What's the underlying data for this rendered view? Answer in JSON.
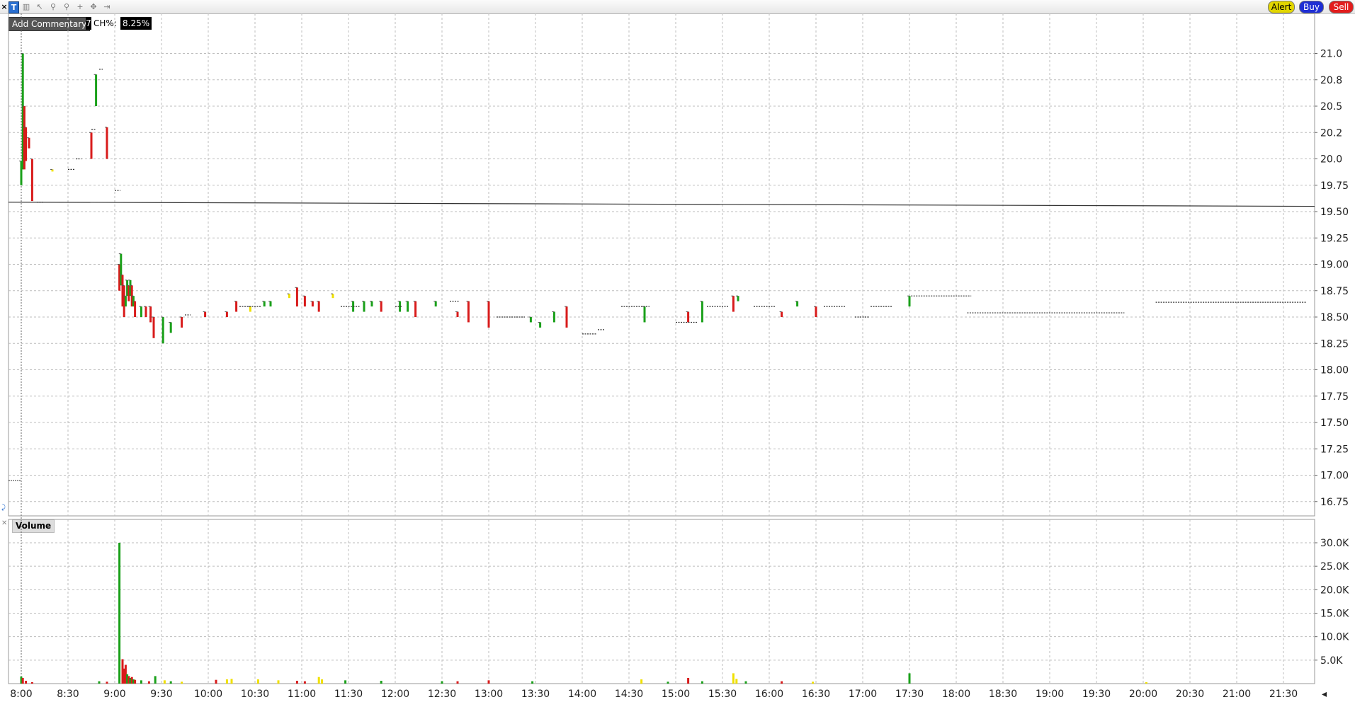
{
  "toolbar": {
    "close_glyph": "×",
    "chart_type_label": "T",
    "tools": [
      {
        "name": "bar-chart-icon",
        "glyph": "▥"
      },
      {
        "name": "cursor-icon",
        "glyph": "↖"
      },
      {
        "name": "zoom-in-icon",
        "glyph": "⚲"
      },
      {
        "name": "zoom-out-icon",
        "glyph": "⚲"
      },
      {
        "name": "crosshair-icon",
        "glyph": "+"
      },
      {
        "name": "move-icon",
        "glyph": "✥"
      },
      {
        "name": "pan-icon",
        "glyph": "⇥"
      }
    ],
    "alert_label": "Alert",
    "buy_label": "Buy",
    "sell_label": "Sell"
  },
  "overlay": {
    "add_commentary": "Add Commentary",
    "marker": "7",
    "ch_label": "CH%:",
    "ch_value": "8.25%"
  },
  "volume_pane": {
    "label": "Volume"
  },
  "colors": {
    "up": "#1aa01a",
    "down": "#d81b1b",
    "flat": "#f0e000",
    "grid": "#bdbdbd",
    "alert_bg": "#e2d600",
    "buy_bg": "#1f2fd4",
    "sell_bg": "#e21d1d"
  },
  "chart_data": {
    "type": "bar",
    "price_axis": {
      "ticks": [
        "21.0",
        "20.8",
        "20.5",
        "20.2",
        "20.0",
        "19.75",
        "19.50",
        "19.25",
        "19.00",
        "18.75",
        "18.50",
        "18.25",
        "18.00",
        "17.75",
        "17.50",
        "17.25",
        "17.00",
        "16.75"
      ],
      "tick_values": [
        21.0,
        20.75,
        20.5,
        20.25,
        20.0,
        19.75,
        19.5,
        19.25,
        19.0,
        18.75,
        18.5,
        18.25,
        18.0,
        17.75,
        17.5,
        17.25,
        17.0,
        16.75
      ]
    },
    "volume_axis": {
      "ticks": [
        "30.0K",
        "25.0K",
        "20.0K",
        "15.0K",
        "10.0K",
        "5.0K"
      ],
      "tick_values": [
        30000,
        25000,
        20000,
        15000,
        10000,
        5000
      ]
    },
    "time_axis": {
      "ticks": [
        "8:00",
        "8:30",
        "9:00",
        "9:30",
        "10:00",
        "10:30",
        "11:00",
        "11:30",
        "12:00",
        "12:30",
        "13:00",
        "13:30",
        "14:00",
        "14:30",
        "15:00",
        "15:30",
        "16:00",
        "16:30",
        "17:00",
        "17:30",
        "18:00",
        "18:30",
        "19:00",
        "19:30",
        "20:00",
        "20:30",
        "21:00",
        "21:30"
      ]
    },
    "reference_line": {
      "start": 19.59,
      "end": 19.55
    },
    "bars": [
      {
        "t": "8:00",
        "h": 19.98,
        "l": 19.75,
        "c": "up"
      },
      {
        "t": "8:01",
        "h": 21.0,
        "l": 19.9,
        "c": "up"
      },
      {
        "t": "8:02",
        "h": 20.5,
        "l": 19.9,
        "c": "down"
      },
      {
        "t": "8:03",
        "h": 20.3,
        "l": 19.98,
        "c": "down"
      },
      {
        "t": "8:05",
        "h": 20.2,
        "l": 20.1,
        "c": "down"
      },
      {
        "t": "8:07",
        "h": 20.0,
        "l": 19.6,
        "c": "down"
      },
      {
        "t": "8:20",
        "h": 19.9,
        "l": 19.88,
        "c": "flat"
      },
      {
        "t": "8:45",
        "h": 20.25,
        "l": 20.0,
        "c": "down"
      },
      {
        "t": "8:48",
        "h": 20.8,
        "l": 20.5,
        "c": "up"
      },
      {
        "t": "8:55",
        "h": 20.3,
        "l": 20.0,
        "c": "down"
      },
      {
        "t": "9:03",
        "h": 19.0,
        "l": 18.75,
        "c": "down"
      },
      {
        "t": "9:04",
        "h": 19.1,
        "l": 18.8,
        "c": "up"
      },
      {
        "t": "9:05",
        "h": 18.9,
        "l": 18.6,
        "c": "down"
      },
      {
        "t": "9:06",
        "h": 18.8,
        "l": 18.5,
        "c": "down"
      },
      {
        "t": "9:07",
        "h": 18.7,
        "l": 18.6,
        "c": "up"
      },
      {
        "t": "9:08",
        "h": 18.85,
        "l": 18.7,
        "c": "up"
      },
      {
        "t": "9:09",
        "h": 18.8,
        "l": 18.65,
        "c": "down"
      },
      {
        "t": "9:10",
        "h": 18.85,
        "l": 18.7,
        "c": "up"
      },
      {
        "t": "9:11",
        "h": 18.8,
        "l": 18.6,
        "c": "down"
      },
      {
        "t": "9:12",
        "h": 18.7,
        "l": 18.6,
        "c": "up"
      },
      {
        "t": "9:13",
        "h": 18.65,
        "l": 18.5,
        "c": "down"
      },
      {
        "t": "9:17",
        "h": 18.6,
        "l": 18.5,
        "c": "up"
      },
      {
        "t": "9:20",
        "h": 18.6,
        "l": 18.5,
        "c": "down"
      },
      {
        "t": "9:23",
        "h": 18.6,
        "l": 18.45,
        "c": "down"
      },
      {
        "t": "9:25",
        "h": 18.5,
        "l": 18.3,
        "c": "down"
      },
      {
        "t": "9:31",
        "h": 18.5,
        "l": 18.25,
        "c": "up"
      },
      {
        "t": "9:36",
        "h": 18.45,
        "l": 18.35,
        "c": "up"
      },
      {
        "t": "9:43",
        "h": 18.5,
        "l": 18.4,
        "c": "down"
      },
      {
        "t": "9:58",
        "h": 18.55,
        "l": 18.5,
        "c": "down"
      },
      {
        "t": "10:12",
        "h": 18.55,
        "l": 18.5,
        "c": "down"
      },
      {
        "t": "10:18",
        "h": 18.65,
        "l": 18.55,
        "c": "down"
      },
      {
        "t": "10:27",
        "h": 18.6,
        "l": 18.55,
        "c": "flat"
      },
      {
        "t": "10:36",
        "h": 18.65,
        "l": 18.6,
        "c": "up"
      },
      {
        "t": "10:40",
        "h": 18.65,
        "l": 18.6,
        "c": "up"
      },
      {
        "t": "10:52",
        "h": 18.72,
        "l": 18.68,
        "c": "flat"
      },
      {
        "t": "10:57",
        "h": 18.78,
        "l": 18.6,
        "c": "down"
      },
      {
        "t": "11:02",
        "h": 18.7,
        "l": 18.6,
        "c": "down"
      },
      {
        "t": "11:07",
        "h": 18.65,
        "l": 18.6,
        "c": "down"
      },
      {
        "t": "11:11",
        "h": 18.65,
        "l": 18.55,
        "c": "down"
      },
      {
        "t": "11:20",
        "h": 18.72,
        "l": 18.68,
        "c": "flat"
      },
      {
        "t": "11:33",
        "h": 18.65,
        "l": 18.55,
        "c": "up"
      },
      {
        "t": "11:40",
        "h": 18.65,
        "l": 18.55,
        "c": "up"
      },
      {
        "t": "11:45",
        "h": 18.65,
        "l": 18.6,
        "c": "up"
      },
      {
        "t": "11:51",
        "h": 18.65,
        "l": 18.55,
        "c": "down"
      },
      {
        "t": "12:03",
        "h": 18.65,
        "l": 18.55,
        "c": "up"
      },
      {
        "t": "12:08",
        "h": 18.65,
        "l": 18.55,
        "c": "up"
      },
      {
        "t": "12:13",
        "h": 18.65,
        "l": 18.5,
        "c": "down"
      },
      {
        "t": "12:26",
        "h": 18.65,
        "l": 18.6,
        "c": "up"
      },
      {
        "t": "12:40",
        "h": 18.55,
        "l": 18.5,
        "c": "down"
      },
      {
        "t": "12:47",
        "h": 18.65,
        "l": 18.45,
        "c": "down"
      },
      {
        "t": "13:00",
        "h": 18.65,
        "l": 18.4,
        "c": "down"
      },
      {
        "t": "13:27",
        "h": 18.5,
        "l": 18.45,
        "c": "up"
      },
      {
        "t": "13:33",
        "h": 18.45,
        "l": 18.4,
        "c": "up"
      },
      {
        "t": "13:42",
        "h": 18.55,
        "l": 18.45,
        "c": "up"
      },
      {
        "t": "13:50",
        "h": 18.6,
        "l": 18.4,
        "c": "down"
      },
      {
        "t": "14:40",
        "h": 18.6,
        "l": 18.45,
        "c": "up"
      },
      {
        "t": "15:08",
        "h": 18.55,
        "l": 18.45,
        "c": "down"
      },
      {
        "t": "15:17",
        "h": 18.65,
        "l": 18.45,
        "c": "up"
      },
      {
        "t": "15:37",
        "h": 18.7,
        "l": 18.55,
        "c": "down"
      },
      {
        "t": "15:40",
        "h": 18.7,
        "l": 18.65,
        "c": "up"
      },
      {
        "t": "16:08",
        "h": 18.55,
        "l": 18.5,
        "c": "down"
      },
      {
        "t": "16:18",
        "h": 18.65,
        "l": 18.6,
        "c": "up"
      },
      {
        "t": "16:30",
        "h": 18.6,
        "l": 18.5,
        "c": "down"
      },
      {
        "t": "17:30",
        "h": 18.7,
        "l": 18.6,
        "c": "up"
      }
    ],
    "dashes": [
      {
        "t": "8:30",
        "p": 19.9,
        "w": 10
      },
      {
        "t": "8:35",
        "p": 20.0,
        "w": 8
      },
      {
        "t": "8:45",
        "p": 20.28,
        "w": 6
      },
      {
        "t": "8:50",
        "p": 20.85,
        "w": 5
      },
      {
        "t": "9:00",
        "p": 19.7,
        "w": 8
      },
      {
        "t": "8:10",
        "p": 19.59,
        "w": 10
      },
      {
        "t": "9:45",
        "p": 18.52,
        "w": 8
      },
      {
        "t": "10:20",
        "p": 18.6,
        "w": 30
      },
      {
        "t": "11:25",
        "p": 18.6,
        "w": 28
      },
      {
        "t": "12:00",
        "p": 18.6,
        "w": 10
      },
      {
        "t": "12:35",
        "p": 18.65,
        "w": 14
      },
      {
        "t": "13:05",
        "p": 18.5,
        "w": 40
      },
      {
        "t": "14:00",
        "p": 18.34,
        "w": 20
      },
      {
        "t": "14:10",
        "p": 18.38,
        "w": 10
      },
      {
        "t": "14:25",
        "p": 18.6,
        "w": 40
      },
      {
        "t": "15:00",
        "p": 18.45,
        "w": 30
      },
      {
        "t": "15:20",
        "p": 18.6,
        "w": 30
      },
      {
        "t": "15:50",
        "p": 18.6,
        "w": 30
      },
      {
        "t": "16:35",
        "p": 18.6,
        "w": 30
      },
      {
        "t": "16:55",
        "p": 18.5,
        "w": 20
      },
      {
        "t": "17:05",
        "p": 18.6,
        "w": 30
      },
      {
        "t": "17:31",
        "p": 18.7,
        "w": 85
      },
      {
        "t": "18:07",
        "p": 18.54,
        "w": 222
      },
      {
        "t": "20:08",
        "p": 18.64,
        "w": 212
      }
    ],
    "volume": [
      {
        "t": "8:00",
        "v": 1500,
        "c": "up"
      },
      {
        "t": "8:01",
        "v": 1200,
        "c": "down"
      },
      {
        "t": "8:03",
        "v": 600,
        "c": "down"
      },
      {
        "t": "8:07",
        "v": 300,
        "c": "down"
      },
      {
        "t": "8:50",
        "v": 500,
        "c": "up"
      },
      {
        "t": "8:55",
        "v": 400,
        "c": "down"
      },
      {
        "t": "9:03",
        "v": 30000,
        "c": "up"
      },
      {
        "t": "9:05",
        "v": 5200,
        "c": "down"
      },
      {
        "t": "9:06",
        "v": 3200,
        "c": "down"
      },
      {
        "t": "9:07",
        "v": 4000,
        "c": "down"
      },
      {
        "t": "9:08",
        "v": 2000,
        "c": "up"
      },
      {
        "t": "9:09",
        "v": 1600,
        "c": "down"
      },
      {
        "t": "9:10",
        "v": 1200,
        "c": "up"
      },
      {
        "t": "9:11",
        "v": 1400,
        "c": "down"
      },
      {
        "t": "9:12",
        "v": 900,
        "c": "up"
      },
      {
        "t": "9:13",
        "v": 800,
        "c": "down"
      },
      {
        "t": "9:17",
        "v": 700,
        "c": "up"
      },
      {
        "t": "9:22",
        "v": 500,
        "c": "down"
      },
      {
        "t": "9:26",
        "v": 1600,
        "c": "up"
      },
      {
        "t": "9:32",
        "v": 700,
        "c": "flat"
      },
      {
        "t": "9:36",
        "v": 500,
        "c": "up"
      },
      {
        "t": "9:43",
        "v": 400,
        "c": "flat"
      },
      {
        "t": "10:05",
        "v": 800,
        "c": "down"
      },
      {
        "t": "10:12",
        "v": 900,
        "c": "flat"
      },
      {
        "t": "10:15",
        "v": 1000,
        "c": "flat"
      },
      {
        "t": "10:32",
        "v": 900,
        "c": "flat"
      },
      {
        "t": "10:45",
        "v": 700,
        "c": "flat"
      },
      {
        "t": "10:57",
        "v": 600,
        "c": "down"
      },
      {
        "t": "11:02",
        "v": 500,
        "c": "down"
      },
      {
        "t": "11:11",
        "v": 1400,
        "c": "flat"
      },
      {
        "t": "11:13",
        "v": 900,
        "c": "flat"
      },
      {
        "t": "11:28",
        "v": 700,
        "c": "up"
      },
      {
        "t": "11:51",
        "v": 600,
        "c": "up"
      },
      {
        "t": "12:30",
        "v": 500,
        "c": "up"
      },
      {
        "t": "12:40",
        "v": 500,
        "c": "down"
      },
      {
        "t": "13:00",
        "v": 700,
        "c": "down"
      },
      {
        "t": "13:28",
        "v": 500,
        "c": "up"
      },
      {
        "t": "14:38",
        "v": 900,
        "c": "flat"
      },
      {
        "t": "14:55",
        "v": 400,
        "c": "up"
      },
      {
        "t": "15:08",
        "v": 1200,
        "c": "down"
      },
      {
        "t": "15:17",
        "v": 500,
        "c": "up"
      },
      {
        "t": "15:37",
        "v": 2200,
        "c": "flat"
      },
      {
        "t": "15:39",
        "v": 1000,
        "c": "flat"
      },
      {
        "t": "15:45",
        "v": 500,
        "c": "up"
      },
      {
        "t": "16:08",
        "v": 500,
        "c": "down"
      },
      {
        "t": "16:28",
        "v": 400,
        "c": "flat"
      },
      {
        "t": "17:30",
        "v": 2200,
        "c": "up"
      },
      {
        "t": "20:02",
        "v": 300,
        "c": "flat"
      }
    ]
  }
}
